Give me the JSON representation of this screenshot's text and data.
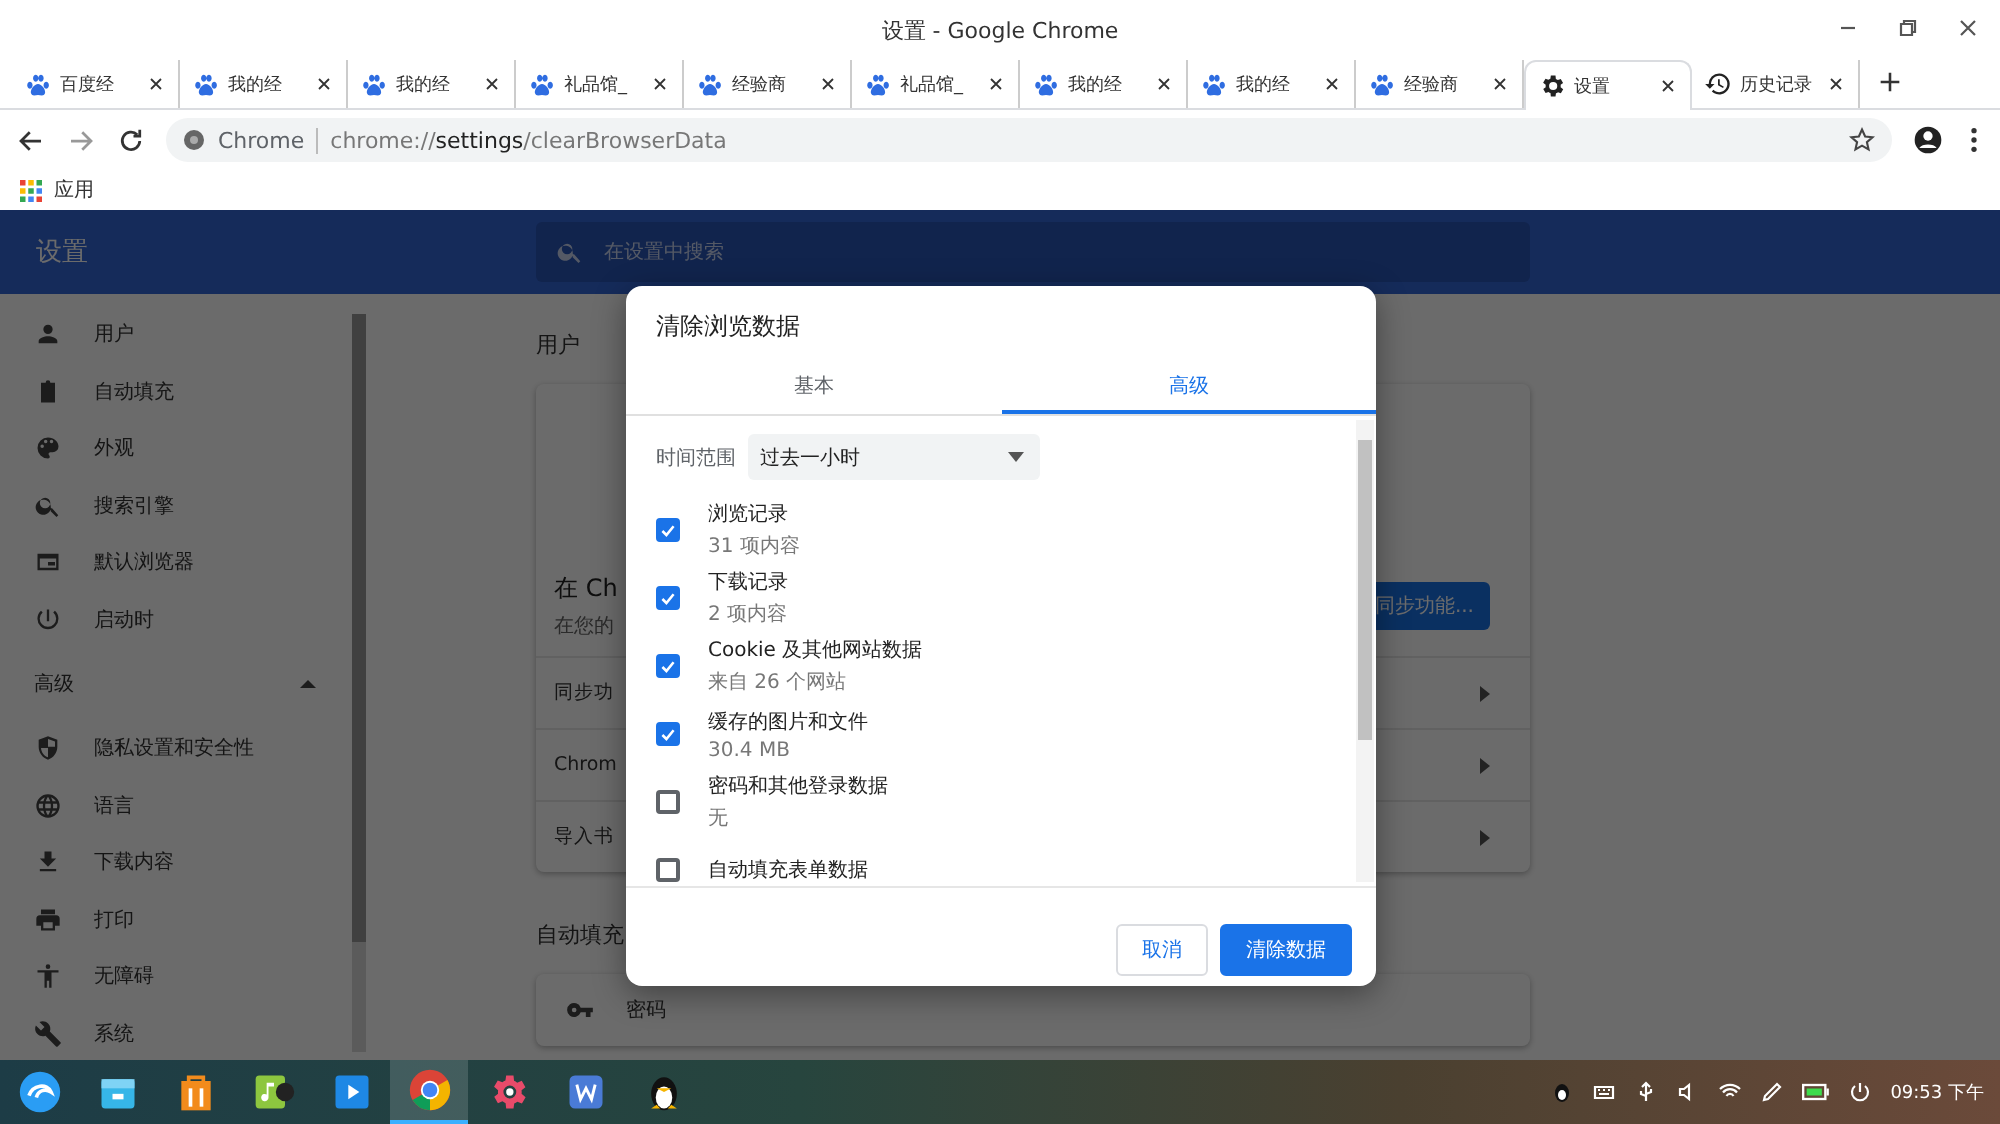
{
  "window": {
    "title": "设置 - Google Chrome"
  },
  "tabs": [
    {
      "kind": "paw",
      "title": "百度经",
      "selected": false
    },
    {
      "kind": "paw",
      "title": "我的经",
      "selected": false
    },
    {
      "kind": "paw",
      "title": "我的经",
      "selected": false
    },
    {
      "kind": "paw",
      "title": "礼品馆_",
      "selected": false
    },
    {
      "kind": "paw",
      "title": "经验商",
      "selected": false
    },
    {
      "kind": "paw",
      "title": "礼品馆_",
      "selected": false
    },
    {
      "kind": "paw",
      "title": "我的经",
      "selected": false
    },
    {
      "kind": "paw",
      "title": "我的经",
      "selected": false
    },
    {
      "kind": "paw",
      "title": "经验商",
      "selected": false
    },
    {
      "kind": "gear",
      "title": "设置",
      "selected": true
    },
    {
      "kind": "history",
      "title": "历史记录",
      "selected": false
    }
  ],
  "address": {
    "chip": "Chrome",
    "scheme": "chrome://",
    "host": "settings",
    "path": "/clearBrowserData"
  },
  "bookmarks": [
    {
      "label": "应用"
    }
  ],
  "settings": {
    "title": "设置",
    "search_placeholder": "在设置中搜索",
    "sidebar": [
      {
        "kind": "person",
        "label": "用户"
      },
      {
        "kind": "clipboard",
        "label": "自动填充"
      },
      {
        "kind": "palette",
        "label": "外观"
      },
      {
        "kind": "search",
        "label": "搜索引擎"
      },
      {
        "kind": "browser",
        "label": "默认浏览器"
      },
      {
        "kind": "power",
        "label": "启动时"
      }
    ],
    "advanced": {
      "label": "高级",
      "expanded": true,
      "items": [
        {
          "kind": "shield",
          "label": "隐私设置和安全性"
        },
        {
          "kind": "globe",
          "label": "语言"
        },
        {
          "kind": "download",
          "label": "下载内容"
        },
        {
          "kind": "print",
          "label": "打印"
        },
        {
          "kind": "accessibility",
          "label": "无障碍"
        },
        {
          "kind": "wrench",
          "label": "系统"
        }
      ]
    },
    "people": {
      "heading": "用户",
      "title": "在 Ch",
      "subtitle": "在您的",
      "sync_button": "同步功能...",
      "rows": [
        "同步功",
        "Chrom",
        "导入书"
      ]
    },
    "autofill": {
      "heading": "自动填充",
      "rows": [
        {
          "kind": "key",
          "label": "密码"
        }
      ]
    }
  },
  "dialog": {
    "title": "清除浏览数据",
    "tabs": [
      {
        "label": "基本",
        "selected": false
      },
      {
        "label": "高级",
        "selected": true
      }
    ],
    "time_range": {
      "label": "时间范围",
      "value": "过去一小时"
    },
    "items": [
      {
        "label": "浏览记录",
        "detail": "31 项内容",
        "checked": true
      },
      {
        "label": "下载记录",
        "detail": "2 项内容",
        "checked": true
      },
      {
        "label": "Cookie 及其他网站数据",
        "detail": "来自 26 个网站",
        "checked": true
      },
      {
        "label": "缓存的图片和文件",
        "detail": "30.4 MB",
        "checked": true
      },
      {
        "label": "密码和其他登录数据",
        "detail": "无",
        "checked": false
      },
      {
        "label": "自动填充表单数据",
        "checked": false
      }
    ],
    "buttons": [
      {
        "label": "取消",
        "kind": "secondary"
      },
      {
        "label": "清除数据",
        "kind": "primary"
      }
    ]
  },
  "taskbar": {
    "apps": [
      {
        "kind": "launcher",
        "selected": false
      },
      {
        "kind": "store",
        "selected": false
      },
      {
        "kind": "bag",
        "selected": false
      },
      {
        "kind": "music",
        "selected": false
      },
      {
        "kind": "video",
        "selected": false
      },
      {
        "kind": "chrome",
        "selected": true
      },
      {
        "kind": "settings",
        "selected": false
      },
      {
        "kind": "writer",
        "selected": false
      },
      {
        "kind": "penguin",
        "selected": false
      }
    ],
    "clock": "09:53 下午"
  }
}
